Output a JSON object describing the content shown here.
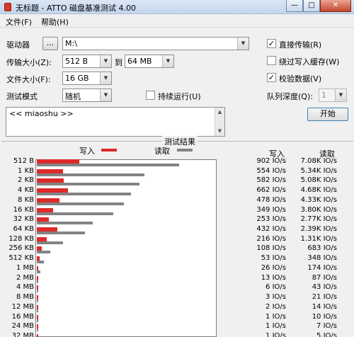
{
  "window": {
    "title": "无标题 - ATTO 磁盘基准测试 4.00",
    "minimize": "—",
    "maximize": "□",
    "close": "✕"
  },
  "menu": {
    "file": "文件(F)",
    "help": "帮助(H)"
  },
  "controls": {
    "drive_label": "驱动器",
    "browse_label": "...",
    "drive_value": "M:\\",
    "transfer_label": "传输大小(Z):",
    "transfer_from": "512 B",
    "transfer_to_label": "到",
    "transfer_to": "64 MB",
    "file_size_label": "文件大小(F):",
    "file_size": "16 GB",
    "test_mode_label": "测试模式",
    "test_mode": "随机",
    "continuous_label": "持续运行(U)",
    "continuous_checked": false,
    "direct_io_label": "直接传输(R)",
    "direct_io_checked": true,
    "bypass_cache_label": "绕过写入缓存(W)",
    "bypass_cache_checked": false,
    "verify_label": "校验数据(V)",
    "verify_checked": true,
    "queue_label": "队列深度(Q):",
    "queue_value": "1",
    "start_label": "开始",
    "check_mark": "✓",
    "dropdown_arrow": "▼"
  },
  "notes": {
    "text": "<< miaoshu >>"
  },
  "results": {
    "group_title": "测试结果",
    "legend_write": "写入",
    "legend_read": "读取",
    "col_write": "写入",
    "col_read": "读取",
    "colors": {
      "write": "#dd2a2a",
      "read": "#838383"
    }
  },
  "chart_data": {
    "type": "bar",
    "orientation": "horizontal",
    "title": "测试结果",
    "unit": "IO/s",
    "categories": [
      "512 B",
      "1 KB",
      "2 KB",
      "4 KB",
      "8 KB",
      "16 KB",
      "32 KB",
      "64 KB",
      "128 KB",
      "256 KB",
      "512 KB",
      "1 MB",
      "2 MB",
      "4 MB",
      "8 MB",
      "12 MB",
      "16 MB",
      "24 MB",
      "32 MB"
    ],
    "series": [
      {
        "name": "写入",
        "values": [
          902,
          554,
          582,
          662,
          478,
          349,
          253,
          432,
          216,
          108,
          53,
          26,
          13,
          6,
          3,
          2,
          1,
          1,
          1
        ]
      },
      {
        "name": "读取",
        "values": [
          7080,
          5340,
          5080,
          4680,
          4330,
          3800,
          2770,
          2390,
          1310,
          683,
          348,
          174,
          87,
          43,
          21,
          14,
          10,
          7,
          5
        ]
      }
    ],
    "write_text": [
      "902 IO/s",
      "554 IO/s",
      "582 IO/s",
      "662 IO/s",
      "478 IO/s",
      "349 IO/s",
      "253 IO/s",
      "432 IO/s",
      "216 IO/s",
      "108 IO/s",
      "53 IO/s",
      "26 IO/s",
      "13 IO/s",
      "6 IO/s",
      "3 IO/s",
      "2 IO/s",
      "1 IO/s",
      "1 IO/s",
      "1 IO/s"
    ],
    "read_text": [
      "7.08K IO/s",
      "5.34K IO/s",
      "5.08K IO/s",
      "4.68K IO/s",
      "4.33K IO/s",
      "3.80K IO/s",
      "2.77K IO/s",
      "2.39K IO/s",
      "1.31K IO/s",
      "683 IO/s",
      "348 IO/s",
      "174 IO/s",
      "87 IO/s",
      "43 IO/s",
      "21 IO/s",
      "14 IO/s",
      "10 IO/s",
      "7 IO/s",
      "5 IO/s"
    ],
    "xlim": [
      0,
      10000
    ]
  }
}
